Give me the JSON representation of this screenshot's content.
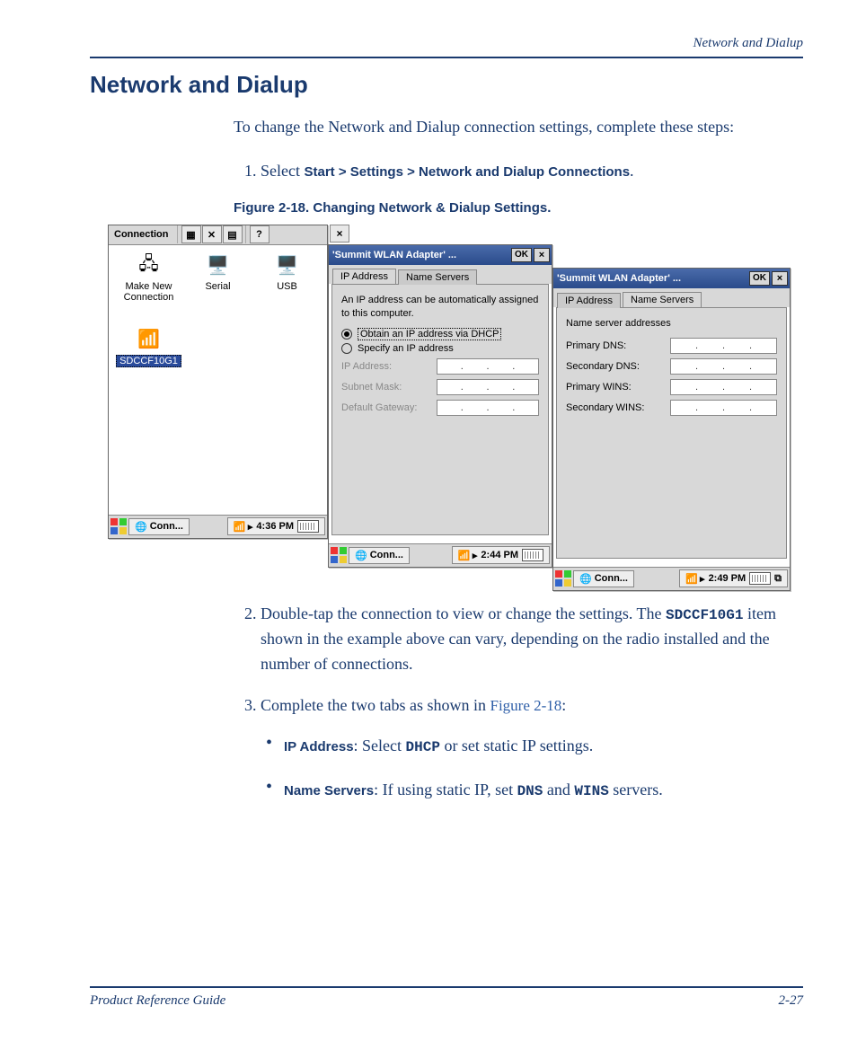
{
  "header": {
    "running": "Network and Dialup"
  },
  "title": "Network and Dialup",
  "intro": "To change the Network and Dialup connection settings, complete these steps:",
  "step1": {
    "lead": "Select ",
    "path": "Start > Settings > Network and Dialup Connections",
    "period": "."
  },
  "figure_caption": "Figure 2-18. Changing Network & Dialup Settings.",
  "win1": {
    "title": "Connection",
    "help": "?",
    "close": "×",
    "icons": {
      "make_new": "Make New Connection",
      "serial": "Serial",
      "usb": "USB",
      "sdc": "SDCCF10G1"
    },
    "task": {
      "conn": "Conn...",
      "time": "4:36 PM"
    }
  },
  "win_close_outer": "×",
  "win2": {
    "title": "'Summit WLAN Adapter' ...",
    "ok": "OK",
    "close": "×",
    "tab1": "IP Address",
    "tab2": "Name Servers",
    "desc": "An IP address can be automatically assigned to this computer.",
    "radio1": "Obtain an IP address via DHCP",
    "radio2": "Specify an IP address",
    "f1": "IP Address:",
    "f2": "Subnet Mask:",
    "f3": "Default Gateway:",
    "task": {
      "conn": "Conn...",
      "time": "2:44 PM"
    }
  },
  "win3": {
    "title": "'Summit WLAN Adapter' ...",
    "ok": "OK",
    "close": "×",
    "tab1": "IP Address",
    "tab2": "Name Servers",
    "desc": "Name server addresses",
    "f1": "Primary DNS:",
    "f2": "Secondary DNS:",
    "f3": "Primary WINS:",
    "f4": "Secondary WINS:",
    "task": {
      "conn": "Conn...",
      "time": "2:49 PM"
    }
  },
  "step2": {
    "a": "Double-tap the connection to view or change the settings. The ",
    "code": "SDCCF10G1",
    "b": " item shown in the example above can vary, depending on the radio installed and the number of connections."
  },
  "step3": {
    "a": "Complete the two tabs as shown in ",
    "ref": "Figure 2-18",
    "b": ":"
  },
  "bullets": {
    "ip": {
      "label": "IP Address",
      "a": ": Select ",
      "code": "DHCP",
      "b": " or set static IP settings."
    },
    "ns": {
      "label": "Name Servers",
      "a": ": If using static IP, set ",
      "code1": "DNS",
      "mid": " and ",
      "code2": "WINS",
      "b": " servers."
    }
  },
  "footer": {
    "guide": "Product Reference Guide",
    "page": "2-27"
  },
  "dot": "."
}
